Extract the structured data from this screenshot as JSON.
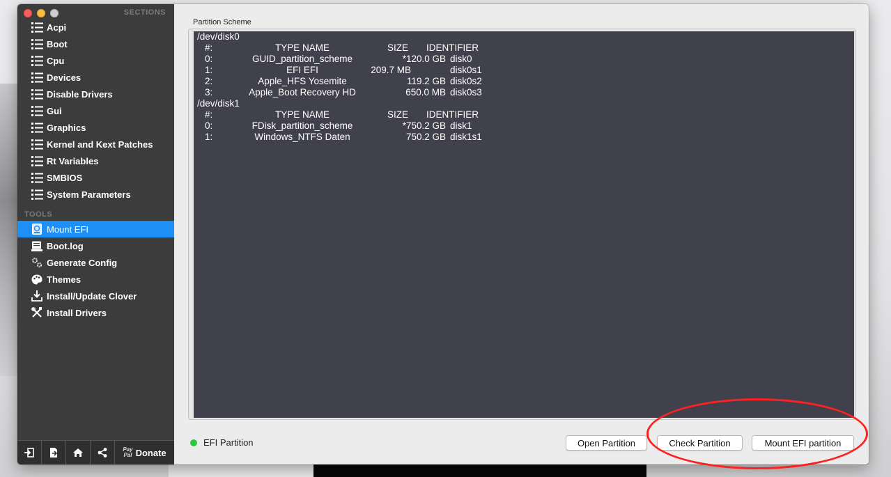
{
  "sidebar": {
    "sections_header": "SECTIONS",
    "tools_header": "TOOLS",
    "sections": [
      {
        "label": "Acpi",
        "icon": "list-icon"
      },
      {
        "label": "Boot",
        "icon": "list-icon"
      },
      {
        "label": "Cpu",
        "icon": "list-icon"
      },
      {
        "label": "Devices",
        "icon": "list-icon"
      },
      {
        "label": "Disable Drivers",
        "icon": "list-icon"
      },
      {
        "label": "Gui",
        "icon": "list-icon"
      },
      {
        "label": "Graphics",
        "icon": "list-icon"
      },
      {
        "label": "Kernel and Kext Patches",
        "icon": "list-icon"
      },
      {
        "label": "Rt Variables",
        "icon": "list-icon"
      },
      {
        "label": "SMBIOS",
        "icon": "list-icon"
      },
      {
        "label": "System Parameters",
        "icon": "list-icon"
      }
    ],
    "tools": [
      {
        "label": "Mount EFI",
        "icon": "disk-icon",
        "selected": true
      },
      {
        "label": "Boot.log",
        "icon": "log-icon"
      },
      {
        "label": "Generate Config",
        "icon": "gears-icon"
      },
      {
        "label": "Themes",
        "icon": "palette-icon"
      },
      {
        "label": "Install/Update Clover",
        "icon": "download-icon"
      },
      {
        "label": "Install Drivers",
        "icon": "tools-icon"
      }
    ],
    "footer": {
      "paypal_top": "Pay",
      "paypal_bottom": "Pal",
      "donate_label": "Donate"
    }
  },
  "main": {
    "box_title": "Partition Scheme",
    "output_lines": [
      {
        "kind": "dev",
        "text": "/dev/disk0"
      },
      {
        "kind": "header",
        "num": "#:",
        "type": "TYPE NAME",
        "size": "SIZE",
        "id": "IDENTIFIER"
      },
      {
        "kind": "row",
        "num": "0:",
        "type": "GUID_partition_scheme",
        "size": "*120.0 GB",
        "id": "disk0"
      },
      {
        "kind": "row",
        "num": "1:",
        "type": "EFI EFI",
        "size": "209.7 MB",
        "id": "disk0s1"
      },
      {
        "kind": "row",
        "num": "2:",
        "type": "Apple_HFS Yosemite",
        "size": "119.2 GB",
        "id": "disk0s2"
      },
      {
        "kind": "row",
        "num": "3:",
        "type": "Apple_Boot Recovery HD",
        "size": "650.0 MB",
        "id": "disk0s3"
      },
      {
        "kind": "dev",
        "text": "/dev/disk1"
      },
      {
        "kind": "header",
        "num": "#:",
        "type": "TYPE NAME",
        "size": "SIZE",
        "id": "IDENTIFIER"
      },
      {
        "kind": "row",
        "num": "0:",
        "type": "FDisk_partition_scheme",
        "size": "*750.2 GB",
        "id": "disk1"
      },
      {
        "kind": "row",
        "num": "1:",
        "type": "Windows_NTFS Daten",
        "size": "750.2 GB",
        "id": "disk1s1"
      }
    ],
    "status_label": "EFI Partition",
    "status_color": "#27c93f",
    "buttons": {
      "open": "Open Partition",
      "check": "Check Partition",
      "mount": "Mount EFI partition"
    }
  },
  "colors": {
    "sidebar_bg": "#3c3c3d",
    "selected": "#1e8ff5",
    "output_bg": "#41414e",
    "annotation": "#ff2020"
  }
}
